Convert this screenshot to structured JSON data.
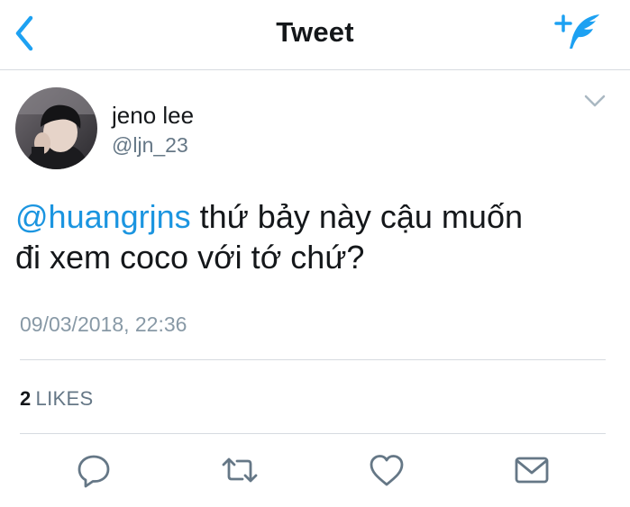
{
  "header": {
    "title": "Tweet",
    "back_icon": "chevron-left-icon",
    "compose_icon": "compose-feather-icon",
    "accent_color": "#1da1f2"
  },
  "author": {
    "name": "jeno lee",
    "handle": "@ljn_23",
    "avatar_icon": "avatar-photo",
    "more_icon": "chevron-down-icon"
  },
  "tweet": {
    "mention": "@huangrjns",
    "text_line1": " thứ bảy này cậu muốn",
    "text_line2": "đi xem coco với tớ chứ?",
    "timestamp": "09/03/2018, 22:36",
    "mention_color": "#1b95e0"
  },
  "stats": {
    "likes_count": "2",
    "likes_label": "LIKES"
  },
  "actions": [
    {
      "icon": "reply-icon"
    },
    {
      "icon": "retweet-icon"
    },
    {
      "icon": "heart-icon"
    },
    {
      "icon": "envelope-icon"
    }
  ]
}
